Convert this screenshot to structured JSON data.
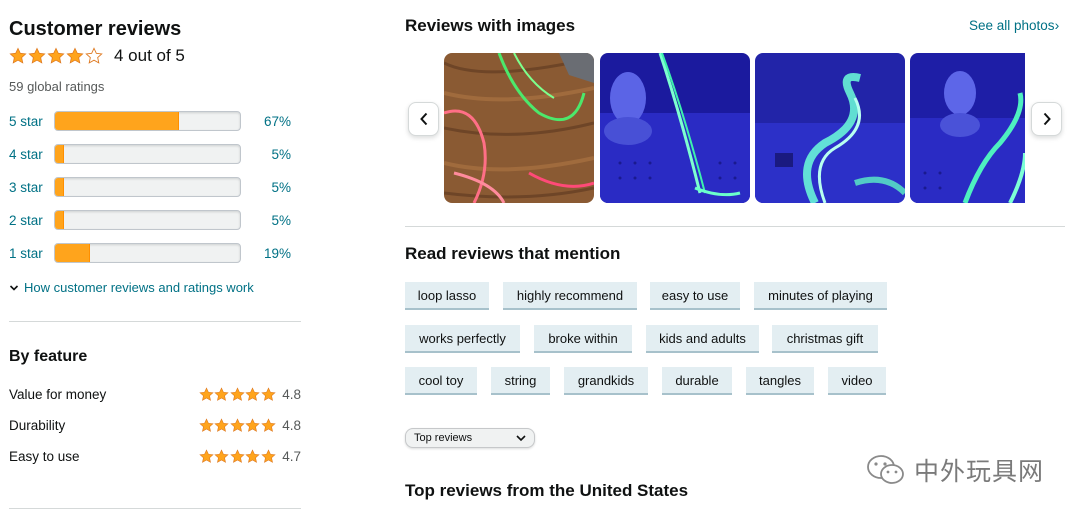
{
  "summary": {
    "title": "Customer reviews",
    "rating_text": "4 out of 5",
    "rating_value": 4,
    "global_ratings": "59 global ratings"
  },
  "histogram": [
    {
      "label": "5 star",
      "percent_text": "67%",
      "percent": 67
    },
    {
      "label": "4 star",
      "percent_text": "5%",
      "percent": 5
    },
    {
      "label": "3 star",
      "percent_text": "5%",
      "percent": 5
    },
    {
      "label": "2 star",
      "percent_text": "5%",
      "percent": 5
    },
    {
      "label": "1 star",
      "percent_text": "19%",
      "percent": 19
    }
  ],
  "how_link": "How customer reviews and ratings work",
  "by_feature": {
    "title": "By feature",
    "items": [
      {
        "name": "Value for money",
        "value": "4.8",
        "stars": 5
      },
      {
        "name": "Durability",
        "value": "4.8",
        "stars": 5
      },
      {
        "name": "Easy to use",
        "value": "4.7",
        "stars": 5
      }
    ]
  },
  "images_section": {
    "title": "Reviews with images",
    "see_all": "See all photos",
    "prev_icon": "chevron-left-icon",
    "next_icon": "chevron-right-icon"
  },
  "mentions": {
    "title": "Read reviews that mention",
    "chips": [
      "loop lasso",
      "highly recommend",
      "easy to use",
      "minutes of playing",
      "works perfectly",
      "broke within",
      "kids and adults",
      "christmas gift",
      "cool toy",
      "string",
      "grandkids",
      "durable",
      "tangles",
      "video"
    ]
  },
  "sort": {
    "selected": "Top reviews"
  },
  "top_reviews_title": "Top reviews from the United States",
  "watermark": "中外玩具网",
  "colors": {
    "star": "#ffa41c",
    "link": "#007185",
    "chip_bg": "#e3eef2"
  }
}
